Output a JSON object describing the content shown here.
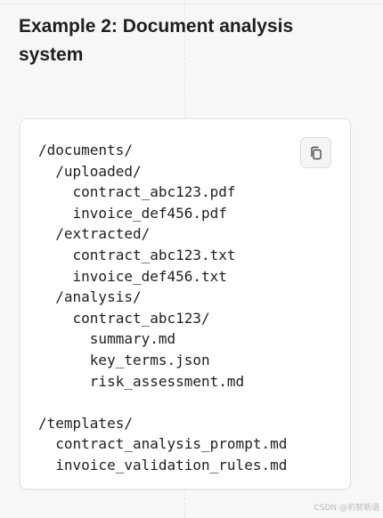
{
  "section": {
    "heading": "Example 2: Document analysis system"
  },
  "code_block": {
    "lines": [
      "/documents/",
      "  /uploaded/",
      "    contract_abc123.pdf",
      "    invoice_def456.pdf",
      "  /extracted/",
      "    contract_abc123.txt",
      "    invoice_def456.txt",
      "  /analysis/",
      "    contract_abc123/",
      "      summary.md",
      "      key_terms.json",
      "      risk_assessment.md",
      "",
      "/templates/",
      "  contract_analysis_prompt.md",
      "  invoice_validation_rules.md"
    ],
    "copy_icon": "copy-icon"
  },
  "watermark": {
    "text": "CSDN @机智新语"
  },
  "colors": {
    "page_background": "#f7f7f6",
    "card_background": "#ffffff",
    "text": "#1f1f1f"
  }
}
